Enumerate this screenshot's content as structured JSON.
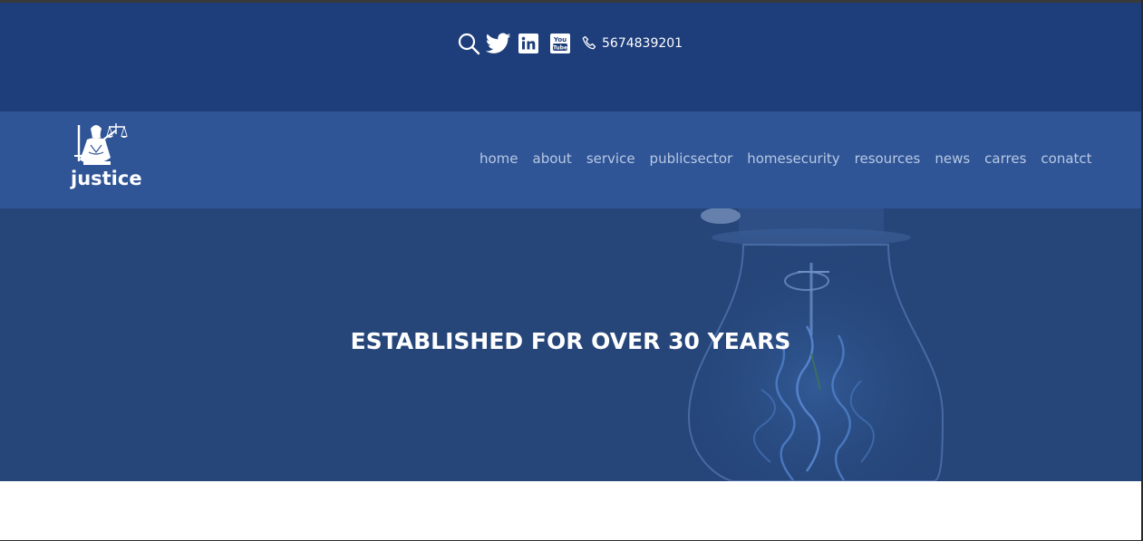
{
  "topbar": {
    "icons": [
      "search-icon",
      "twitter-icon",
      "linkedin-icon",
      "youtube-icon",
      "phone-icon"
    ],
    "phone": "5674839201",
    "youtube_text_top": "You",
    "youtube_text_bottom": "Tube"
  },
  "header": {
    "logo_text": "justice",
    "nav": [
      "home",
      "about",
      "service",
      "publicsector",
      "homesecurity",
      "resources",
      "news",
      "carres",
      "conatct"
    ]
  },
  "hero": {
    "title": "ESTABLISHED FOR OVER 30 YEARS",
    "background_image": "light-bulb"
  },
  "colors": {
    "topbar": "#1e3d7b",
    "navbar": "#2f5597",
    "hero": "#26467a",
    "nav_text": "#b8c8e3",
    "white": "#ffffff"
  }
}
